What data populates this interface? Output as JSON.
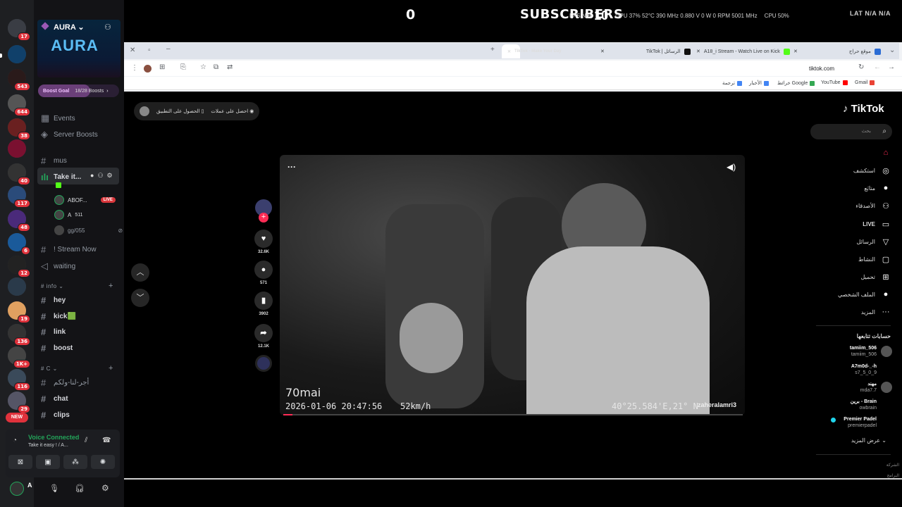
{
  "overlay": {
    "subscriber_count": "0",
    "subscribers_label": "SUBSCRIBERS",
    "fps_label": "FPS N/A",
    "fps_value": "10",
    "gpu": "GPU 37% 52°C 390 MHz 0.880 V 0 W 0 RPM 5001 MHz",
    "cpu": "CPU 50%",
    "lat": "LAT N/A N/A"
  },
  "discord": {
    "server_name": "AURA",
    "logo_text": "AURA",
    "rail_badges": [
      "17",
      "543",
      "644",
      "38",
      "40",
      "117",
      "48",
      "6",
      "12",
      "19",
      "136",
      "1K+",
      "116",
      "29"
    ],
    "new_label": "NEW",
    "boost_goal": "Boost Goal",
    "boost_progress": "18/28 Boosts",
    "boost_fraction": 0.64,
    "events": "Events",
    "server_boosts": "Server Boosts",
    "channels_top": [
      "mus"
    ],
    "active_channel": "Take it...",
    "voice_users": [
      {
        "name": "ABOF...",
        "live": "LIVE"
      },
      {
        "name": "A",
        "extra": "511"
      },
      {
        "name": "gg/055"
      }
    ],
    "channels_mid": [
      "! Stream Now",
      "waiting"
    ],
    "cat_info": "# info",
    "info_channels": [
      "hey",
      "kick🟩",
      "link",
      "boost"
    ],
    "cat_c": "# C",
    "c_channels": [
      "أجر-لنا-ولكم",
      "chat",
      "clips"
    ],
    "voice_connected": "Voice Connected",
    "voice_channel": "Take it easy ! / A...",
    "user_name": "A"
  },
  "browser": {
    "tabs": [
      "TikTok - Make Your Day",
      "TikTok | الرسائل",
      "A18_i Stream - Watch Live on Kick",
      "موقع حراج"
    ],
    "url": "tiktok.com",
    "bookmarks": [
      "ترجمة",
      "الأخبار",
      "خرائط Google",
      "YouTube",
      "Gmail"
    ]
  },
  "tiktok": {
    "logo": "TikTok",
    "search_placeholder": "بحث",
    "promo_left": "الحصول على التطبيق",
    "promo_right": "احصل على عملات",
    "nav": [
      "",
      "استكشف",
      "متابَع",
      "الأصدقاء",
      "LIVE",
      "الرسائل",
      "النشاط",
      "تحميل",
      "الملف الشخصي",
      "المزيد"
    ],
    "likes": "32.6K",
    "comments": "571",
    "saves": "3902",
    "shares": "12.1K",
    "video_brand": "70mai",
    "video_timestamp": "2026-01-06 20:47:56",
    "video_speed": "52km/h",
    "video_gps": "40°25.584'E,21° N",
    "video_user": "zaheralamri3",
    "following_header": "حسابات تتابعها",
    "following": [
      {
        "name": "tamiim_506",
        "handle": "tamiim_506"
      },
      {
        "name": "A7m0d-_-h",
        "handle": "s7_5_0_9"
      },
      {
        "name": "مهند",
        "handle": "mda7.7"
      },
      {
        "name": "برين - Brain",
        "handle": "owbrain"
      },
      {
        "name": "Premier Padel",
        "handle": "premierpadel"
      }
    ],
    "see_more": "عرض المزيد",
    "footer": [
      "الشركة",
      "البرامج"
    ]
  }
}
